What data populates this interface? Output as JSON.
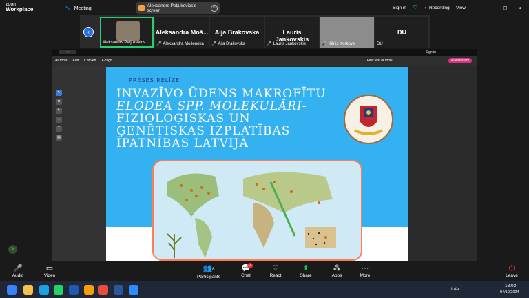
{
  "app": {
    "logo_line1": "zoom",
    "logo_line2": "Workplace",
    "meeting_label": "Meeting"
  },
  "share": {
    "label": "Aleksandrs Petjukevics's screen"
  },
  "top_right": {
    "sign_in": "Sign in",
    "recording": "Recording",
    "view": "View"
  },
  "participants": [
    {
      "name": "Aleksandrs Petjukevics",
      "big": ""
    },
    {
      "name": "Aleksandra Mošenoka",
      "big": "Aleksandra Moš..."
    },
    {
      "name": "Aija Brakovska",
      "big": "Aija Brakovska"
    },
    {
      "name": "Lauris Jankovskis",
      "big": "Lauris Jankovskis"
    },
    {
      "name": "Kārlis Korkovs",
      "big": ""
    },
    {
      "name": "DU",
      "big": "DU"
    }
  ],
  "viewer": {
    "menu": [
      "All tools",
      "Edit",
      "Convert",
      "E-Sign"
    ],
    "find": "Find text or tools",
    "assistant": "AI Assistant",
    "sign_in": "Sign in"
  },
  "slide": {
    "kicker": "PRESES RELĪZE",
    "title_lines": [
      "INVAZĪVO ŪDENS MAKROFĪTU",
      "ELODEA SPP. MOLEKULĀRI-",
      "FIZIOLOĢISKAS UN",
      "ĢENĒTISKAS IZPLATĪBAS",
      "ĪPATNĪBAS LATVIJĀ"
    ]
  },
  "toolbar": {
    "audio": "Audio",
    "video": "Video",
    "participants": "Participants",
    "participants_count": "8",
    "chat": "Chat",
    "chat_badge": "2",
    "react": "React",
    "share": "Share",
    "apps": "Apps",
    "more": "More",
    "leave": "Leave"
  },
  "taskbar": {
    "lang": "LAV",
    "time": "13:03",
    "date": "04/10/2024"
  },
  "colors": {
    "accent": "#2d6fe0",
    "slide_bg": "#33b1f0",
    "share_green": "#1db954",
    "record_red": "#e53935"
  }
}
